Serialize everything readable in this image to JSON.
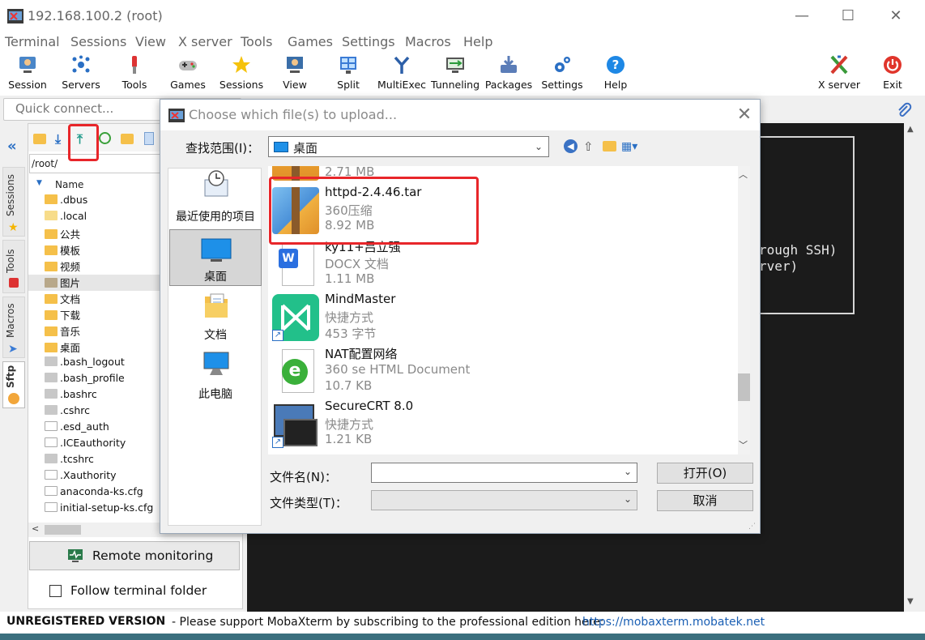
{
  "window": {
    "title": "192.168.100.2 (root)",
    "minimize": "—",
    "maximize": "☐",
    "close": "✕"
  },
  "menu": [
    "Terminal",
    "Sessions",
    "View",
    "X server",
    "Tools",
    "Games",
    "Settings",
    "Macros",
    "Help"
  ],
  "toolbar": [
    {
      "label": "Session",
      "icon": "session-icon"
    },
    {
      "label": "Servers",
      "icon": "servers-icon"
    },
    {
      "label": "Tools",
      "icon": "tools-icon"
    },
    {
      "label": "Games",
      "icon": "games-icon"
    },
    {
      "label": "Sessions",
      "icon": "star-icon"
    },
    {
      "label": "View",
      "icon": "view-icon"
    },
    {
      "label": "Split",
      "icon": "split-icon"
    },
    {
      "label": "MultiExec",
      "icon": "multiexec-icon"
    },
    {
      "label": "Tunneling",
      "icon": "tunneling-icon"
    },
    {
      "label": "Packages",
      "icon": "packages-icon"
    },
    {
      "label": "Settings",
      "icon": "settings-icon"
    },
    {
      "label": "Help",
      "icon": "help-icon"
    }
  ],
  "toolbar_right": [
    {
      "label": "X server",
      "icon": "x-server-icon"
    },
    {
      "label": "Exit",
      "icon": "exit-icon"
    }
  ],
  "quick_connect": {
    "placeholder": "Quick connect..."
  },
  "side_tabs": [
    "Sessions",
    "Tools",
    "Macros",
    "Sftp"
  ],
  "sftp": {
    "path": "/root/",
    "column_header": "Name",
    "items": [
      {
        "name": ".dbus",
        "kind": "folder"
      },
      {
        "name": ".local",
        "kind": "folder-light"
      },
      {
        "name": "公共",
        "kind": "folder"
      },
      {
        "name": "模板",
        "kind": "folder"
      },
      {
        "name": "视频",
        "kind": "folder"
      },
      {
        "name": "图片",
        "kind": "folder-gray",
        "selected": true
      },
      {
        "name": "文档",
        "kind": "folder"
      },
      {
        "name": "下载",
        "kind": "folder"
      },
      {
        "name": "音乐",
        "kind": "folder"
      },
      {
        "name": "桌面",
        "kind": "folder"
      },
      {
        "name": ".bash_logout",
        "kind": "file-gray"
      },
      {
        "name": ".bash_profile",
        "kind": "file-gray"
      },
      {
        "name": ".bashrc",
        "kind": "file-gray"
      },
      {
        "name": ".cshrc",
        "kind": "file-gray"
      },
      {
        "name": ".esd_auth",
        "kind": "file"
      },
      {
        "name": ".ICEauthority",
        "kind": "file"
      },
      {
        "name": ".tcshrc",
        "kind": "file-gray"
      },
      {
        "name": ".Xauthority",
        "kind": "file"
      },
      {
        "name": "anaconda-ks.cfg",
        "kind": "cfg"
      },
      {
        "name": "initial-setup-ks.cfg",
        "kind": "cfg"
      }
    ],
    "remote_monitoring": "Remote monitoring",
    "follow_terminal": "Follow terminal folder"
  },
  "terminal": {
    "lines": [
      "rough SSH)",
      "rver)"
    ]
  },
  "status": {
    "unregistered": "UNREGISTERED VERSION",
    "message": "-  Please support MobaXterm by subscribing to the professional edition here:",
    "link": "https://mobaxterm.mobatek.net"
  },
  "dialog": {
    "title": "Choose which file(s) to upload...",
    "look_in_label": "查找范围(I)：",
    "look_in_value": "桌面",
    "places": [
      {
        "label": "最近使用的项目",
        "icon": "recent-icon"
      },
      {
        "label": "桌面",
        "icon": "desktop-icon",
        "selected": true
      },
      {
        "label": "文档",
        "icon": "documents-icon"
      },
      {
        "label": "此电脑",
        "icon": "this-pc-icon"
      }
    ],
    "files": [
      {
        "name": "",
        "type": "",
        "size": "2.71 MB",
        "icon": "archive-icon"
      },
      {
        "name": "httpd-2.4.46.tar",
        "type": "360压缩",
        "size": "8.92 MB",
        "icon": "archive-icon"
      },
      {
        "name": "ky11+吕立强",
        "type": "DOCX 文档",
        "size": "1.11 MB",
        "icon": "docx-icon"
      },
      {
        "name": "MindMaster",
        "type": "快捷方式",
        "size": "453 字节",
        "icon": "mindmaster-icon"
      },
      {
        "name": "NAT配置网络",
        "type": "360 se HTML Document",
        "size": "10.7 KB",
        "icon": "html-icon"
      },
      {
        "name": "SecureCRT 8.0",
        "type": "快捷方式",
        "size": "1.21 KB",
        "icon": "securecrt-icon"
      }
    ],
    "file_name_label": "文件名(N)：",
    "file_type_label": "文件类型(T)：",
    "open_button": "打开(O)",
    "cancel_button": "取消"
  },
  "colors": {
    "highlight": "#e8262a",
    "link": "#1a5fb4",
    "terminal_bg": "#1b1b1b"
  }
}
